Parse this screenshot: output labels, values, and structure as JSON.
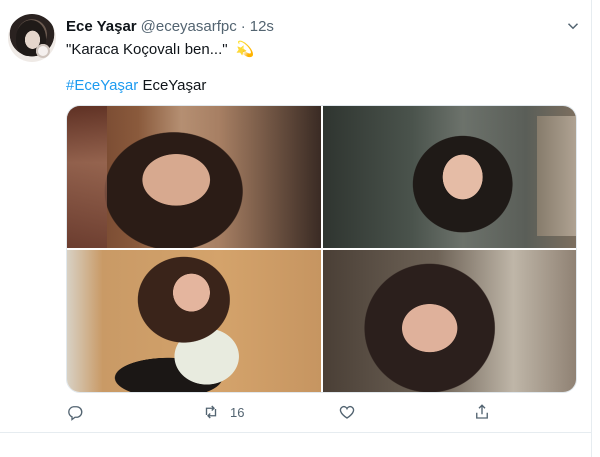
{
  "tweet": {
    "author_name": "Ece Yaşar",
    "handle": "@eceyasarfpc",
    "separator": "·",
    "time": "12s",
    "text": "\"Karaca Koçovalı ben...\"",
    "text_emoji": "💫",
    "hashtag": "#EceYaşar",
    "after_hashtag": "EceYaşar"
  },
  "media": {
    "count": 4,
    "photos": [
      "photo-1",
      "photo-2",
      "photo-3",
      "photo-4"
    ]
  },
  "actions": {
    "reply_count": "",
    "retweet_count": "16",
    "like_count": "",
    "share_count": ""
  },
  "colors": {
    "accent": "#1d9bf0",
    "muted": "#536471",
    "emoji": "#f4c542"
  },
  "icons": [
    "more-icon",
    "reply-icon",
    "retweet-icon",
    "like-icon",
    "share-icon"
  ]
}
